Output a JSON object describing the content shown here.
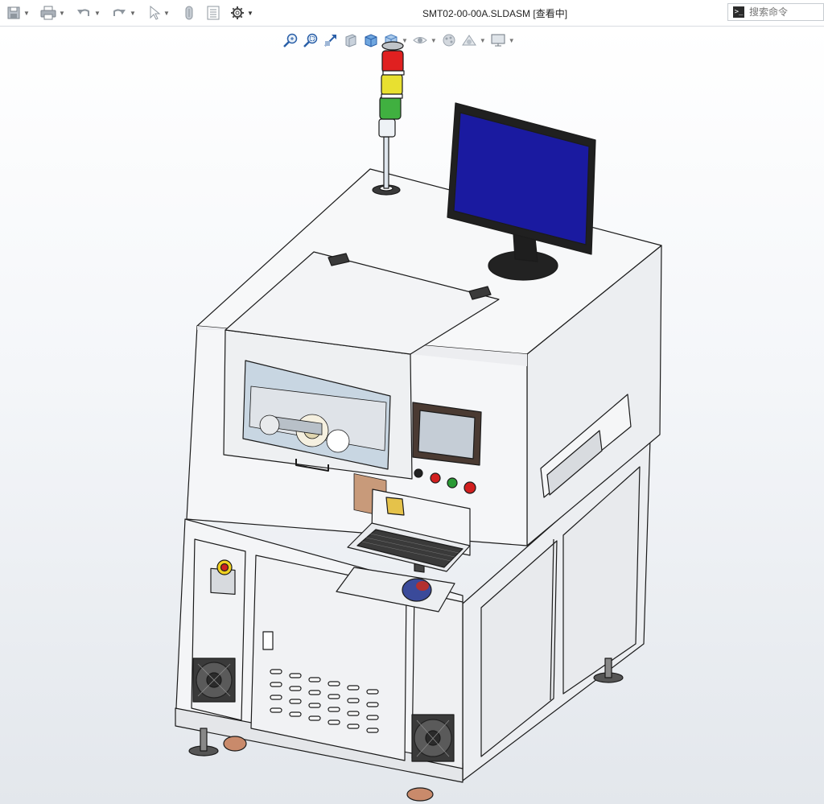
{
  "app": {
    "document_title": "SMT02-00-00A.SLDASM [查看中]"
  },
  "toolbar": {
    "items": [
      "save-icon",
      "print-icon",
      "undo-icon",
      "redo-icon",
      "select-icon",
      "rebuild-icon",
      "file-properties-icon",
      "options-icon"
    ]
  },
  "search": {
    "placeholder": "搜索命令",
    "prompt_glyph": ">_"
  },
  "heads_up_toolbar": {
    "items": [
      "zoom-to-fit-icon",
      "zoom-to-area-icon",
      "previous-view-icon",
      "section-view-icon",
      "view-orientation-icon",
      "display-style-icon",
      "hide-show-items-icon",
      "edit-appearance-icon",
      "apply-scene-icon",
      "view-settings-icon"
    ]
  },
  "colors": {
    "viewport_top": "#ffffff",
    "viewport_bottom": "#e3e7ec",
    "monitor_screen": "#1a1aa0",
    "tower_red": "#e02020",
    "tower_yellow": "#e8e030",
    "tower_green": "#40b040",
    "button_red": "#d21f1f",
    "button_green": "#2a9a35",
    "mouse_blue": "#3a4a9a"
  }
}
